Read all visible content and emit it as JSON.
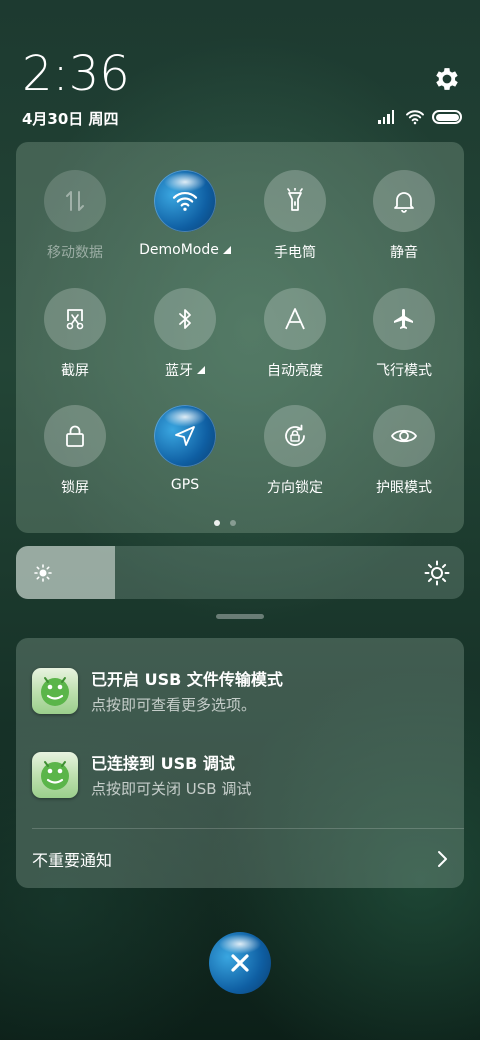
{
  "status_bar": {
    "time": "2:36",
    "date": "4月30日 周四",
    "icons": [
      "signal-icon",
      "wifi-icon",
      "battery-icon"
    ]
  },
  "header": {
    "settings_icon": "gear-icon"
  },
  "quick_settings": {
    "tiles": [
      {
        "label": "移动数据",
        "icon": "mobile-data-icon",
        "state": "disabled"
      },
      {
        "label": "DemoMode",
        "icon": "wifi-icon",
        "state": "active",
        "has_menu": true
      },
      {
        "label": "手电筒",
        "icon": "flashlight-icon",
        "state": "off"
      },
      {
        "label": "静音",
        "icon": "bell-icon",
        "state": "off"
      },
      {
        "label": "截屏",
        "icon": "screenshot-icon",
        "state": "off"
      },
      {
        "label": "蓝牙",
        "icon": "bluetooth-icon",
        "state": "off",
        "has_menu": true
      },
      {
        "label": "自动亮度",
        "icon": "auto-brightness-icon",
        "state": "off"
      },
      {
        "label": "飞行模式",
        "icon": "airplane-icon",
        "state": "off"
      },
      {
        "label": "锁屏",
        "icon": "lock-icon",
        "state": "off"
      },
      {
        "label": "GPS",
        "icon": "location-arrow-icon",
        "state": "active"
      },
      {
        "label": "方向锁定",
        "icon": "rotation-lock-icon",
        "state": "off"
      },
      {
        "label": "护眼模式",
        "icon": "eye-icon",
        "state": "off"
      }
    ],
    "page": 1,
    "pages": 2
  },
  "brightness": {
    "level": 0.22
  },
  "notifications": [
    {
      "title": "已开启 USB 文件传输模式",
      "subtitle": "点按即可查看更多选项。",
      "icon": "android-icon"
    },
    {
      "title": "已连接到 USB 调试",
      "subtitle": "点按即可关闭 USB 调试",
      "icon": "android-icon"
    }
  ],
  "unimportant": {
    "label": "不重要通知"
  },
  "colors": {
    "accent": "#1e82c8",
    "panel": "#7fa08c"
  }
}
